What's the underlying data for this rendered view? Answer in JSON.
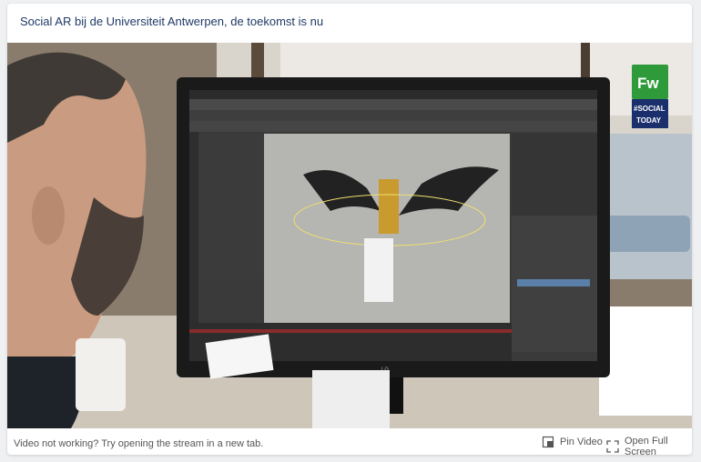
{
  "title": "Social AR bij de Universiteit Antwerpen, de toekomst is nu",
  "footer": {
    "message": "Video not working? Try opening the stream in a new tab.",
    "pin_label": "Pin Video",
    "fullscreen_label": "Open Full Screen"
  },
  "badge": {
    "logo_text": "Fw",
    "line1": "#SOCIAL",
    "line2": "TODAY",
    "logo_color": "#2e9a3a",
    "tag_color": "#1a2f6b"
  },
  "monitor": {
    "brand": "LG"
  },
  "colors": {
    "title": "#1f3a66",
    "background": "#eef0f2"
  }
}
